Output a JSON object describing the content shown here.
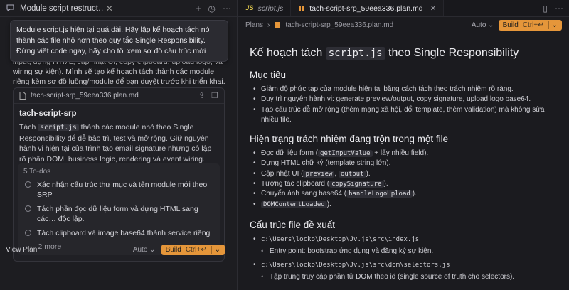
{
  "left": {
    "tab_title": "Module script restruct…",
    "prompt": "Module script.js hiện tại quá dài. Hãy lập kế hoạch tách nó thành các file nhỏ hơn theo quy tắc Single Responsibility. Đừng viết code ngay, hãy cho tôi xem sơ đồ cấu trúc mới",
    "response_partial": "input, dựng HTML, cập nhật UI, copy clipboard, upload logo, và wiring sự kiện). Mình sẽ tạo kế hoạch tách thành các module riêng kèm sơ đồ luồng/module để bạn duyệt trước khi triển khai.",
    "plan_card": {
      "filename": "tach-script-srp_59eea336.plan.md",
      "title": "tach-script-srp",
      "desc_pre": "Tách ",
      "desc_code": "script.js",
      "desc_post": " thành các module nhỏ theo Single Responsibility để dễ bảo trì, test và mở rộng. Giữ nguyên hành vi hiện tại của trình tạo email signature nhưng cô lập rõ phần DOM, business logic, rendering và event wiring.",
      "todos_count": "5 To-dos",
      "todos": [
        "Xác nhận cấu trúc thư mục và tên module mới theo SRP",
        "Tách phần đọc dữ liệu form và dựng HTML sang các… độc lập.",
        "Tách clipboard và image base64 thành service riêng"
      ],
      "more": "2 more",
      "view_plan": "View Plan",
      "auto": "Auto",
      "build": "Build",
      "build_kbd": "Ctrl+↵"
    }
  },
  "right": {
    "tabs": [
      {
        "badge": "JS",
        "label": "script.js"
      },
      {
        "label": "tach-script-srp_59eea336.plan.md"
      }
    ],
    "breadcrumb": [
      "Plans",
      "tach-script-srp_59eea336.plan.md"
    ],
    "auto": "Auto",
    "build": "Build",
    "build_kbd": "Ctrl+↵",
    "doc": {
      "h1_pre": "Kế hoạch tách ",
      "h1_code": "script.js",
      "h1_post": " theo Single Responsibility",
      "sec1_title": "Mục tiêu",
      "sec1_items": [
        "Giảm độ phức tạp của module hiện tại bằng cách tách theo trách nhiệm rõ ràng.",
        "Duy trì nguyên hành vi: generate preview/output, copy signature, upload logo base64.",
        "Tạo cấu trúc dễ mở rộng (thêm mạng xã hội, đổi template, thêm validation) mà không sửa nhiều file."
      ],
      "sec2_title": "Hiện trạng trách nhiệm đang trộn trong một file",
      "sec2_i1_pre": "Đọc dữ liệu form (",
      "sec2_i1_code": "getInputValue",
      "sec2_i1_post": " + lấy nhiều field).",
      "sec2_i2": "Dựng HTML chữ ký (template string lớn).",
      "sec2_i3_pre": "Cập nhật UI (",
      "sec2_i3_code1": "preview",
      "sec2_i3_mid": ", ",
      "sec2_i3_code2": "output",
      "sec2_i3_post": ").",
      "sec2_i4_pre": "Tương tác clipboard (",
      "sec2_i4_code": "copySignature",
      "sec2_i4_post": ").",
      "sec2_i5_pre": "Chuyển ảnh sang base64 (",
      "sec2_i5_code": "handleLogoUpload",
      "sec2_i5_post": ").",
      "sec2_i6_code": "DOMContentLoaded",
      "sec2_i6_post": ").",
      "sec3_title": "Cấu trúc file đề xuất",
      "path1": "c:\\Users\\locko\\Desktop\\Jv.js\\src\\index.js",
      "path1_sub": "Entry point: bootstrap ứng dụng và đăng ký sự kiện.",
      "path2": "c:\\Users\\locko\\Desktop\\Jv.js\\src\\dom\\selectors.js",
      "path2_sub": "Tập trung truy cập phần tử DOM theo id (single source of truth cho selectors)."
    }
  }
}
